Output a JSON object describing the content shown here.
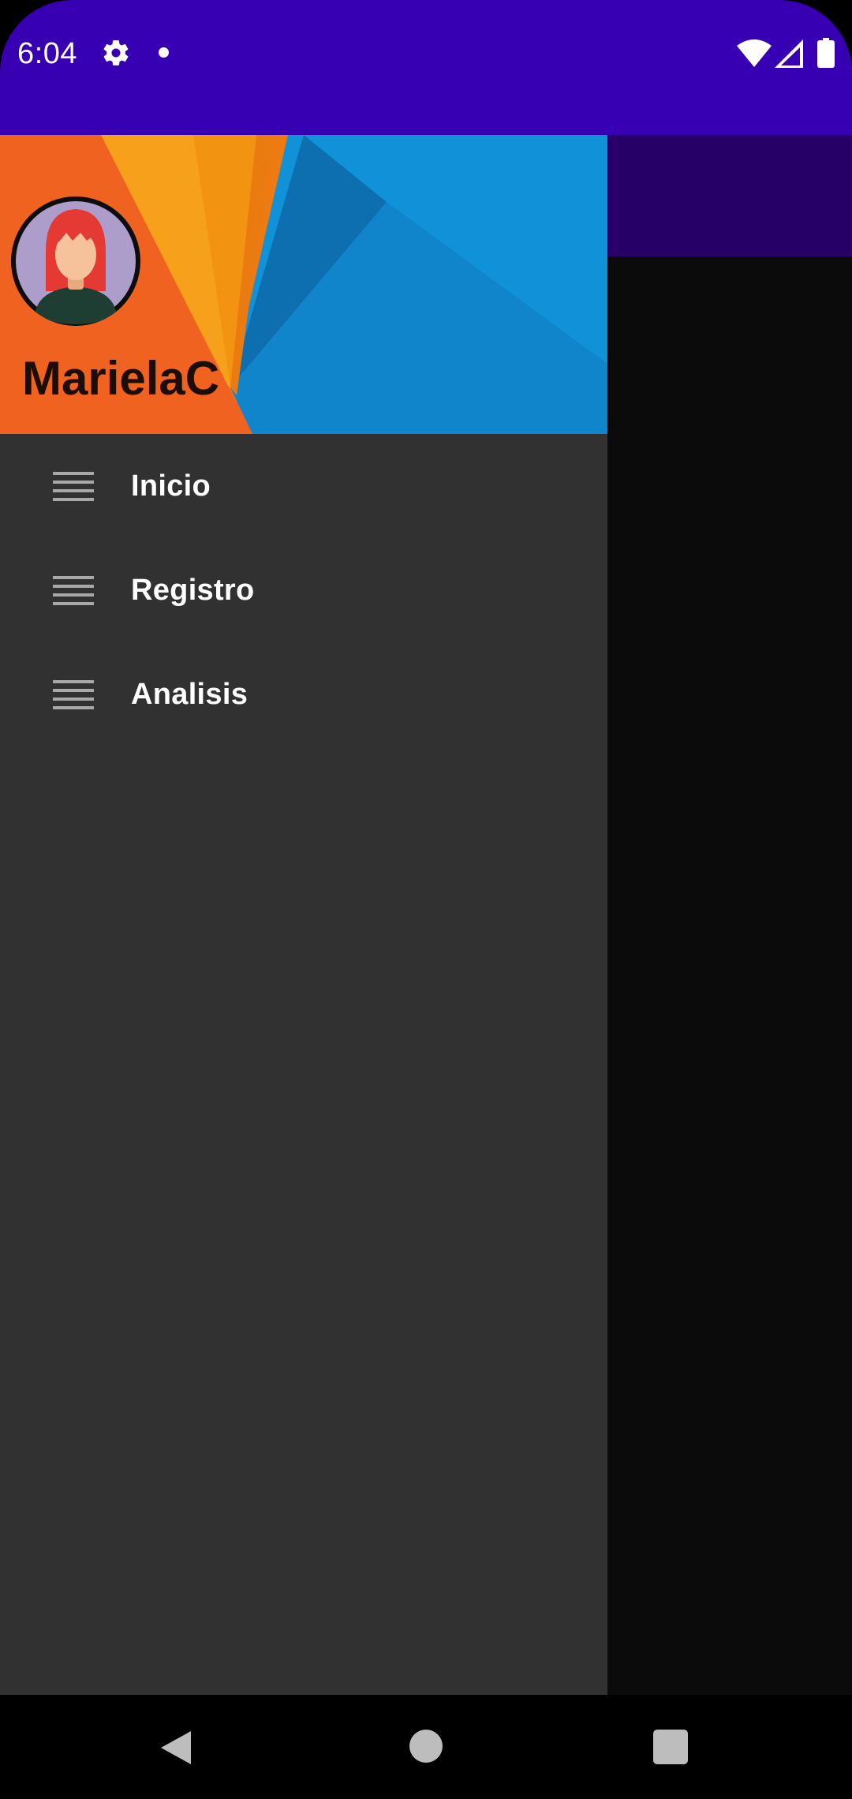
{
  "status_bar": {
    "time": "6:04",
    "icons": [
      "gear-icon",
      "notification-dot-icon",
      "wifi-icon",
      "cell-signal-icon",
      "battery-icon"
    ],
    "background": "#3700b3"
  },
  "drawer": {
    "user_name": "MarielaC",
    "menu_items": [
      {
        "label": "Inicio",
        "icon": "menu-lines-icon"
      },
      {
        "label": "Registro",
        "icon": "menu-lines-icon"
      },
      {
        "label": "Analisis",
        "icon": "menu-lines-icon"
      }
    ],
    "background": "#313131"
  },
  "nav_bar": {
    "buttons": [
      "back-icon",
      "home-icon",
      "recents-icon"
    ]
  },
  "colors": {
    "primary": "#3700b3",
    "header_orange": "#f0621f",
    "header_yellow": "#f7a21e",
    "header_blue": "#1192d8"
  }
}
